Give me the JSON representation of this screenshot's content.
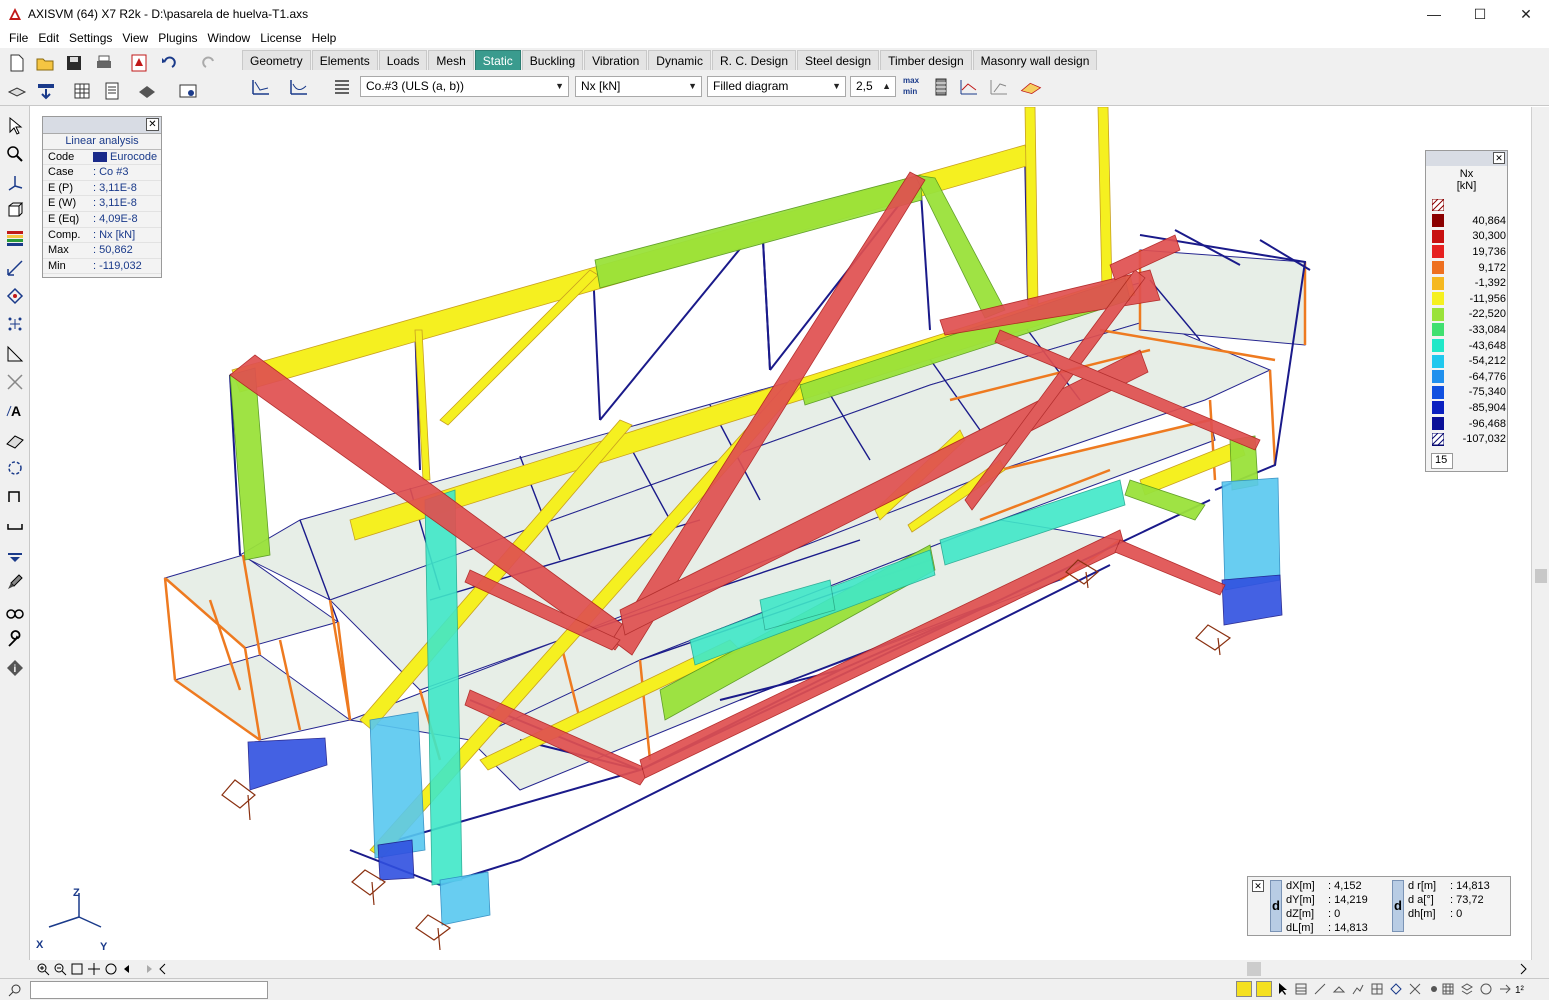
{
  "window": {
    "title": "AXISVM (64) X7 R2k - D:\\pasarela de huelva-T1.axs",
    "controls": {
      "minimize": "—",
      "maximize": "☐",
      "close": "✕"
    }
  },
  "menu": [
    "File",
    "Edit",
    "Settings",
    "View",
    "Plugins",
    "Window",
    "License",
    "Help"
  ],
  "tabs": [
    "Geometry",
    "Elements",
    "Loads",
    "Mesh",
    "Static",
    "Buckling",
    "Vibration",
    "Dynamic",
    "R. C. Design",
    "Steel design",
    "Timber design",
    "Masonry wall design"
  ],
  "active_tab": "Static",
  "result_toolbar": {
    "load_case": "Co.#3 (ULS (a, b))",
    "component": "Nx [kN]",
    "display_mode": "Filled diagram",
    "scale": "2,5",
    "max_label": "max",
    "min_label": "min"
  },
  "info_panel": {
    "title": "Linear analysis",
    "rows": [
      {
        "k": "Code",
        "v": "Eurocode"
      },
      {
        "k": "Case",
        "v": ": Co #3"
      },
      {
        "k": "E (P)",
        "v": ": 3,11E-8"
      },
      {
        "k": "E (W)",
        "v": ": 3,11E-8"
      },
      {
        "k": "E (Eq)",
        "v": ": 4,09E-8"
      },
      {
        "k": "Comp.",
        "v": ": Nx [kN]"
      },
      {
        "k": "Max",
        "v": ": 50,862"
      },
      {
        "k": "Min",
        "v": ": -119,032"
      }
    ]
  },
  "legend": {
    "title_line1": "Nx",
    "title_line2": "[kN]",
    "entries": [
      {
        "value": "40,864",
        "color": "#8b0000"
      },
      {
        "value": "30,300",
        "color": "#c81010"
      },
      {
        "value": "19,736",
        "color": "#e62020"
      },
      {
        "value": "9,172",
        "color": "#ee7020"
      },
      {
        "value": "-1,392",
        "color": "#f5b820"
      },
      {
        "value": "-11,956",
        "color": "#f5f020"
      },
      {
        "value": "-22,520",
        "color": "#9ae23a"
      },
      {
        "value": "-33,084",
        "color": "#40e070"
      },
      {
        "value": "-43,648",
        "color": "#20e8c8"
      },
      {
        "value": "-54,212",
        "color": "#20c8ee"
      },
      {
        "value": "-64,776",
        "color": "#2090ee"
      },
      {
        "value": "-75,340",
        "color": "#1050e0"
      },
      {
        "value": "-85,904",
        "color": "#0a20c0"
      },
      {
        "value": "-96,468",
        "color": "#0a1098"
      },
      {
        "value": "-107,032",
        "color": "#060870"
      }
    ],
    "count": "15"
  },
  "coords": {
    "left": [
      {
        "k": "dX[m]",
        "v": ": 4,152"
      },
      {
        "k": "dY[m]",
        "v": ": 14,219"
      },
      {
        "k": "dZ[m]",
        "v": ": 0"
      },
      {
        "k": "dL[m]",
        "v": ": 14,813"
      }
    ],
    "right": [
      {
        "k": "d r[m]",
        "v": ": 14,813"
      },
      {
        "k": "d a[°]",
        "v": ": 73,72"
      },
      {
        "k": "dh[m]",
        "v": ": 0"
      }
    ],
    "d_label": "d"
  },
  "axes": {
    "x": "X",
    "y": "Y",
    "z": "Z"
  },
  "colors": {
    "tension": "#e04848",
    "compression_light": "#f5f020",
    "compression_mid": "#9ae23a",
    "compression_high": "#20e8c8",
    "member_line": "#1a1a8a",
    "deck": "#e8f0e8",
    "active_tab": "#3a9b8e"
  }
}
